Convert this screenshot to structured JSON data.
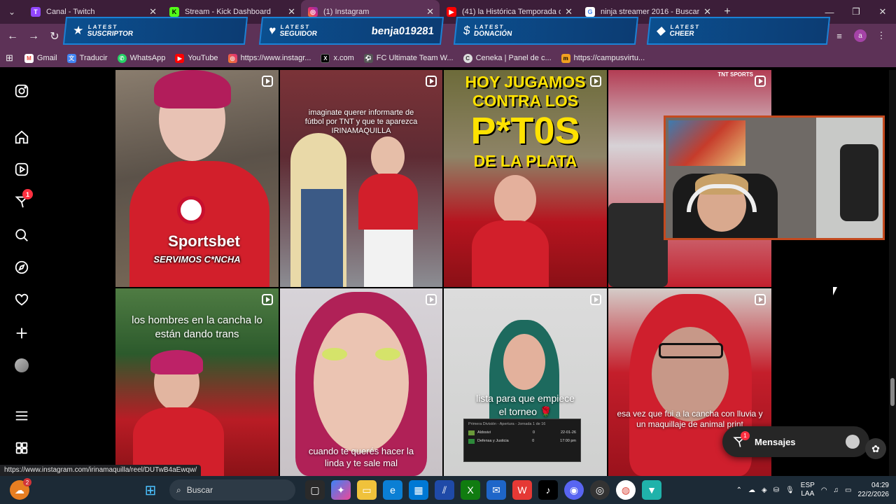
{
  "browser": {
    "tabs": [
      {
        "title": "Canal - Twitch",
        "color": "#9146ff",
        "glyph": "T"
      },
      {
        "title": "Stream - Kick Dashboard",
        "color": "#53fc18",
        "glyph": "K"
      },
      {
        "title": "(1) Instagram",
        "color": "#e1306c",
        "glyph": "◎"
      },
      {
        "title": "(41) la Histórica Temporada de",
        "color": "#ff0000",
        "glyph": "▶"
      },
      {
        "title": "ninja streamer 2016 - Buscar co",
        "color": "#4285f4",
        "glyph": "G"
      }
    ],
    "profile_initial": "a",
    "bookmarks": [
      {
        "label": "Gmail",
        "color": "#ea4335",
        "glyph": "M"
      },
      {
        "label": "Traducir",
        "color": "#4285f4",
        "glyph": "文"
      },
      {
        "label": "WhatsApp",
        "color": "#25d366",
        "glyph": "✆"
      },
      {
        "label": "YouTube",
        "color": "#ff0000",
        "glyph": "▶"
      },
      {
        "label": "https://www.instagr...",
        "color": "#e1306c",
        "glyph": "◎"
      },
      {
        "label": "x.com",
        "color": "#000000",
        "glyph": "X"
      },
      {
        "label": "FC Ultimate Team W...",
        "color": "#555555",
        "glyph": "⚽"
      },
      {
        "label": "Ceneka | Panel de c...",
        "color": "#dddddd",
        "glyph": "C"
      },
      {
        "label": "https://campusvirtu...",
        "color": "#f0a020",
        "glyph": "m"
      }
    ],
    "status_url": "https://www.instagram.com/irinamaquilla/reel/DUTwB4aEwqw/"
  },
  "overlay": {
    "alerts": [
      {
        "small": "LATEST",
        "big": "SUSCRIPTOR",
        "value": "",
        "icon": "★"
      },
      {
        "small": "LATEST",
        "big": "SEGUIDOR",
        "value": "benja019281",
        "icon": "♥"
      },
      {
        "small": "LATEST",
        "big": "DONACIÓN",
        "value": "",
        "icon": "$"
      },
      {
        "small": "LATEST",
        "big": "CHEER",
        "value": "",
        "icon": "◆"
      }
    ]
  },
  "instagram": {
    "notifications_badge": "1",
    "tiles": [
      {
        "caption": "SERVIMOS C*NCHA",
        "sponsor": "Sportsbet"
      },
      {
        "caption": "imaginate querer informarte de fútbol por TNT y que te aparezca IRINAMAQUILLA"
      },
      {
        "caption_l1": "HOY JUGAMOS",
        "caption_l2": "CONTRA LOS",
        "caption_l3": "P*T0S",
        "caption_l4": "DE LA PLATA"
      },
      {
        "caption": "",
        "brand": "TNT SPORTS"
      },
      {
        "caption": "los hombres en la cancha lo están dando trans"
      },
      {
        "caption": "cuando te querés hacer la linda y te sale mal"
      },
      {
        "caption": "lista para que empiece el torneo 🌹",
        "scoreboard": {
          "title": "Primera División - Apertura - Jornada 1 de 16",
          "team1": "Aldosivi",
          "team2": "Defensa y Justicia",
          "score1": "0",
          "score2": "0",
          "date": "22-01-26",
          "time": "17:00 pm"
        }
      },
      {
        "caption": "esa vez que fui a la cancha con lluvia y un maquillaje de animal print"
      }
    ],
    "messages": {
      "label": "Mensajes",
      "badge": "1"
    }
  },
  "taskbar": {
    "search_placeholder": "Buscar",
    "start_badge": "2",
    "lang_top": "ESP",
    "lang_bottom": "LAA",
    "time": "04:29",
    "date": "22/2/2026"
  }
}
